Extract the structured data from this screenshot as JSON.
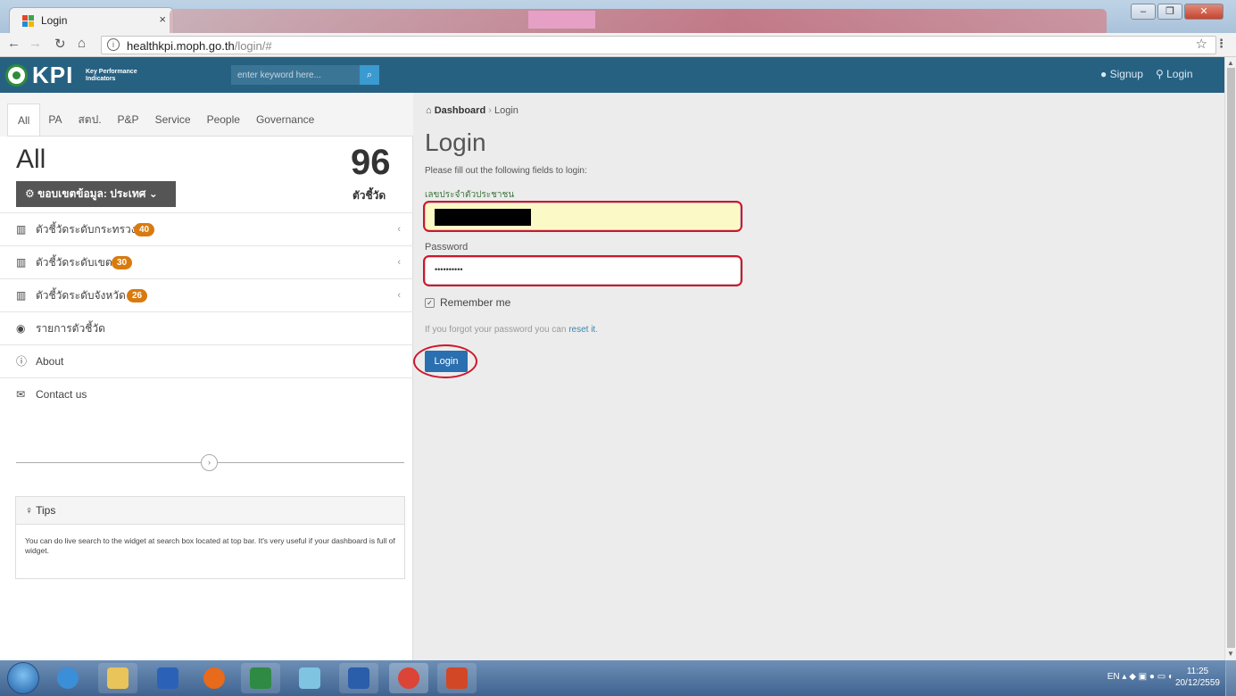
{
  "browser": {
    "tab_title": "Login",
    "tab_close": "×",
    "url_host": "healthkpi.moph.go.th",
    "url_path": "/login/#",
    "window_controls": [
      "–",
      "❐",
      "✕"
    ]
  },
  "header": {
    "logo_text": "KPI",
    "logo_subtitle": "Key Performance Indicators",
    "search_placeholder": "enter keyword here...",
    "signup_label": "Signup",
    "login_label": "Login"
  },
  "sidebar": {
    "tabs": [
      "All",
      "PA",
      "สตป.",
      "P&P",
      "Service",
      "People",
      "Governance"
    ],
    "title": "All",
    "count": "96",
    "count_label": "ตัวชี้วัด",
    "scope_button": "ขอบเขตข้อมูล: ประเทศ",
    "items": [
      {
        "icon": "bar-chart-icon",
        "label": "ตัวชี้วัดระดับกระทรวง",
        "badge": "40"
      },
      {
        "icon": "bar-chart-icon",
        "label": "ตัวชี้วัดระดับเขต",
        "badge": "30"
      },
      {
        "icon": "bar-chart-icon",
        "label": "ตัวชี้วัดระดับจังหวัด",
        "badge": "26"
      },
      {
        "icon": "dashboard-icon",
        "label": "รายการตัวชี้วัด"
      },
      {
        "icon": "info-icon",
        "label": "About"
      },
      {
        "icon": "envelope-icon",
        "label": "Contact us"
      }
    ],
    "tips_title": "Tips",
    "tips_body": "You can do live search to the widget at search box located at top bar. It's very useful if your dashboard is full of widget."
  },
  "main": {
    "breadcrumb_home": "Dashboard",
    "breadcrumb_current": "Login",
    "title": "Login",
    "intro": "Please fill out the following fields to login:",
    "id_label": "เลขประจำตัวประชาชน",
    "password_label": "Password",
    "password_mask": "••••••••••",
    "remember_label": "Remember me",
    "forgot_text": "If you forgot your password you can ",
    "forgot_link": "reset it",
    "forgot_end": ".",
    "login_button": "Login"
  },
  "taskbar": {
    "lang": "EN",
    "time": "11:25",
    "date": "20/12/2559"
  },
  "colors": {
    "header_bg": "#276182",
    "badge": "#d97a0f",
    "login_btn": "#2a6fb0",
    "annotation_red": "#d0152a"
  }
}
